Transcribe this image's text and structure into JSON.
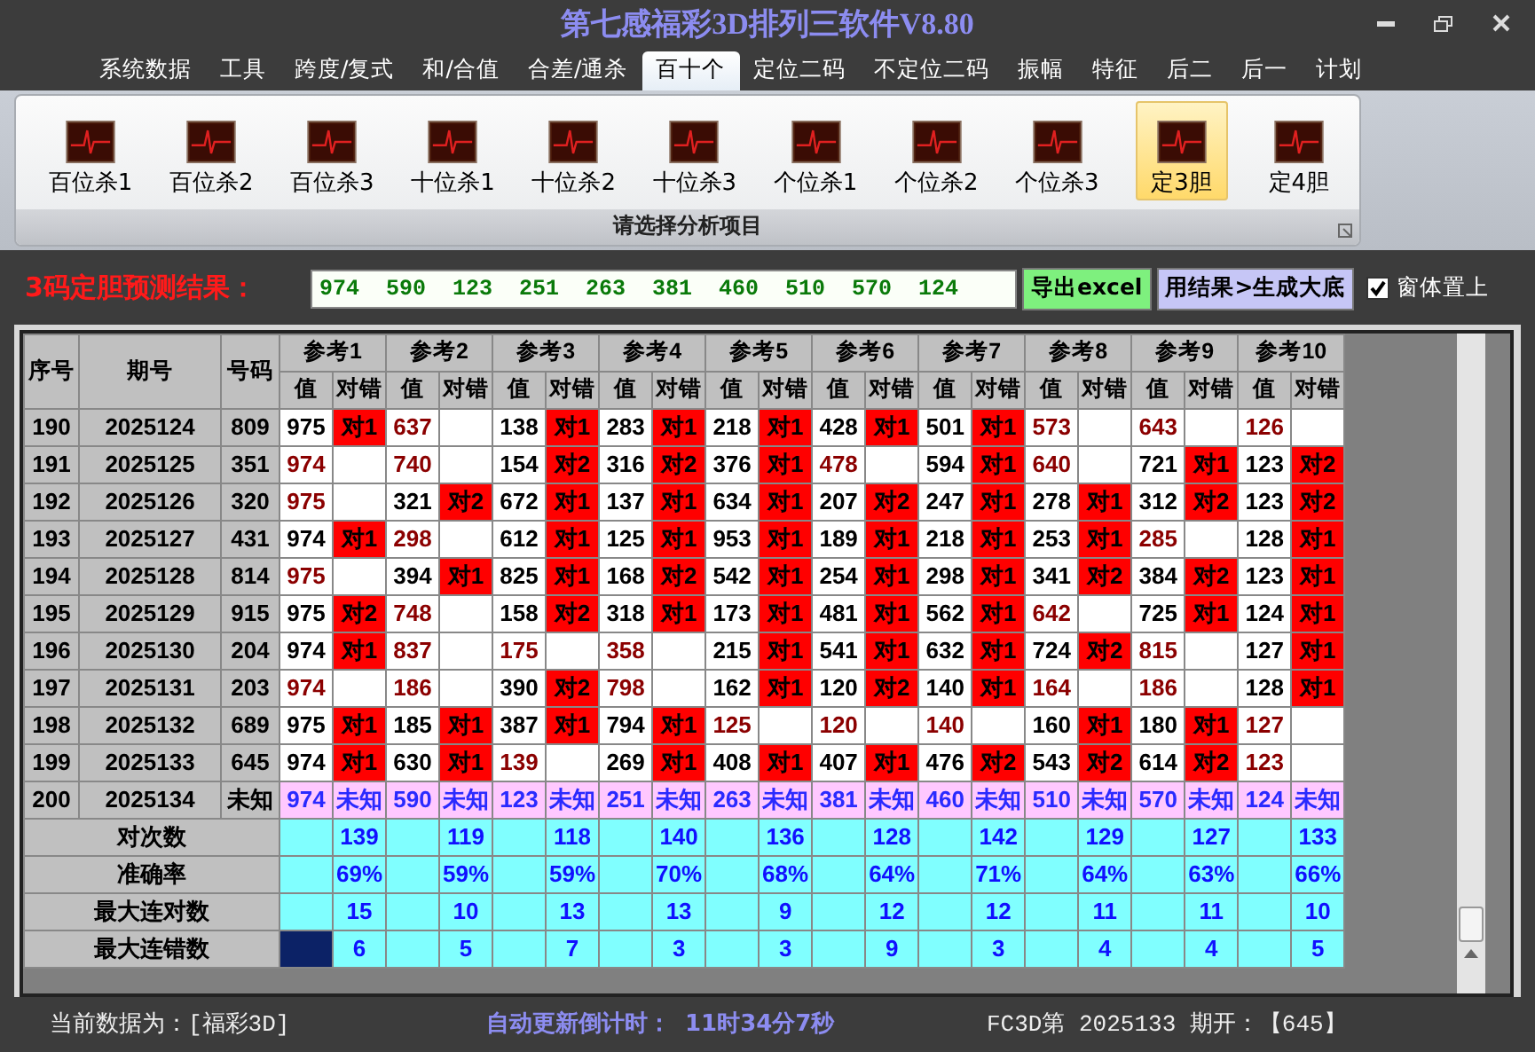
{
  "window": {
    "title": "第七感福彩3D排列三软件V8.80"
  },
  "menu": [
    {
      "label": "系统数据",
      "selected": false
    },
    {
      "label": "工具",
      "selected": false
    },
    {
      "label": "跨度/复式",
      "selected": false
    },
    {
      "label": "和/合值",
      "selected": false
    },
    {
      "label": "合差/通杀",
      "selected": false
    },
    {
      "label": "百十个",
      "selected": true
    },
    {
      "label": "定位二码",
      "selected": false
    },
    {
      "label": "不定位二码",
      "selected": false
    },
    {
      "label": "振幅",
      "selected": false
    },
    {
      "label": "特征",
      "selected": false
    },
    {
      "label": "后二",
      "selected": false
    },
    {
      "label": "后一",
      "selected": false
    },
    {
      "label": "计划",
      "selected": false
    }
  ],
  "ribbon": {
    "buttons": [
      {
        "label": "百位杀1",
        "selected": false
      },
      {
        "label": "百位杀2",
        "selected": false
      },
      {
        "label": "百位杀3",
        "selected": false
      },
      {
        "label": "十位杀1",
        "selected": false
      },
      {
        "label": "十位杀2",
        "selected": false
      },
      {
        "label": "十位杀3",
        "selected": false
      },
      {
        "label": "个位杀1",
        "selected": false
      },
      {
        "label": "个位杀2",
        "selected": false
      },
      {
        "label": "个位杀3",
        "selected": false
      },
      {
        "label": "定3胆",
        "selected": true
      },
      {
        "label": "定4胆",
        "selected": false
      }
    ],
    "group_label": "请选择分析项目"
  },
  "prediction": {
    "label": "3码定胆预测结果：",
    "value": "974  590  123  251  263  381  460  510  570  124",
    "buttons": [
      {
        "label": "导出excel",
        "kind": "export"
      },
      {
        "label": "用结果>生成大底",
        "kind": "generate"
      }
    ],
    "pin_on_top": {
      "label": "窗体置上",
      "checked": true
    }
  },
  "table": {
    "columns": [
      "序号",
      "期号",
      "号码"
    ],
    "groups": [
      {
        "label": "参考1",
        "subcolumns": [
          "值",
          "对错"
        ]
      },
      {
        "label": "参考2",
        "subcolumns": [
          "值",
          "对错"
        ]
      },
      {
        "label": "参考3",
        "subcolumns": [
          "值",
          "对错"
        ]
      },
      {
        "label": "参考4",
        "subcolumns": [
          "值",
          "对错"
        ]
      },
      {
        "label": "参考5",
        "subcolumns": [
          "值",
          "对错"
        ]
      },
      {
        "label": "参考6",
        "subcolumns": [
          "值",
          "对错"
        ]
      },
      {
        "label": "参考7",
        "subcolumns": [
          "值",
          "对错"
        ]
      },
      {
        "label": "参考8",
        "subcolumns": [
          "值",
          "对错"
        ]
      },
      {
        "label": "参考9",
        "subcolumns": [
          "值",
          "对错"
        ]
      },
      {
        "label": "参考10",
        "subcolumns": [
          "值",
          "对错"
        ]
      }
    ],
    "rows": [
      {
        "kind": "history",
        "no": "190",
        "period": "2025124",
        "number": "809",
        "cells": [
          {
            "value": "975",
            "mark": "对1"
          },
          {
            "value": "637"
          },
          {
            "value": "138",
            "mark": "对1"
          },
          {
            "value": "283",
            "mark": "对1"
          },
          {
            "value": "218",
            "mark": "对1"
          },
          {
            "value": "428",
            "mark": "对1"
          },
          {
            "value": "501",
            "mark": "对1"
          },
          {
            "value": "573"
          },
          {
            "value": "643"
          },
          {
            "value": "126"
          }
        ]
      },
      {
        "kind": "history",
        "no": "191",
        "period": "2025125",
        "number": "351",
        "cells": [
          {
            "value": "974"
          },
          {
            "value": "740"
          },
          {
            "value": "154",
            "mark": "对2"
          },
          {
            "value": "316",
            "mark": "对2"
          },
          {
            "value": "376",
            "mark": "对1"
          },
          {
            "value": "478"
          },
          {
            "value": "594",
            "mark": "对1"
          },
          {
            "value": "640"
          },
          {
            "value": "721",
            "mark": "对1"
          },
          {
            "value": "123",
            "mark": "对2"
          }
        ]
      },
      {
        "kind": "history",
        "no": "192",
        "period": "2025126",
        "number": "320",
        "cells": [
          {
            "value": "975"
          },
          {
            "value": "321",
            "mark": "对2"
          },
          {
            "value": "672",
            "mark": "对1"
          },
          {
            "value": "137",
            "mark": "对1"
          },
          {
            "value": "634",
            "mark": "对1"
          },
          {
            "value": "207",
            "mark": "对2"
          },
          {
            "value": "247",
            "mark": "对1"
          },
          {
            "value": "278",
            "mark": "对1"
          },
          {
            "value": "312",
            "mark": "对2"
          },
          {
            "value": "123",
            "mark": "对2"
          }
        ]
      },
      {
        "kind": "history",
        "no": "193",
        "period": "2025127",
        "number": "431",
        "cells": [
          {
            "value": "974",
            "mark": "对1"
          },
          {
            "value": "298"
          },
          {
            "value": "612",
            "mark": "对1"
          },
          {
            "value": "125",
            "mark": "对1"
          },
          {
            "value": "953",
            "mark": "对1"
          },
          {
            "value": "189",
            "mark": "对1"
          },
          {
            "value": "218",
            "mark": "对1"
          },
          {
            "value": "253",
            "mark": "对1"
          },
          {
            "value": "285"
          },
          {
            "value": "128",
            "mark": "对1"
          }
        ]
      },
      {
        "kind": "history",
        "no": "194",
        "period": "2025128",
        "number": "814",
        "cells": [
          {
            "value": "975"
          },
          {
            "value": "394",
            "mark": "对1"
          },
          {
            "value": "825",
            "mark": "对1"
          },
          {
            "value": "168",
            "mark": "对2"
          },
          {
            "value": "542",
            "mark": "对1"
          },
          {
            "value": "254",
            "mark": "对1"
          },
          {
            "value": "298",
            "mark": "对1"
          },
          {
            "value": "341",
            "mark": "对2"
          },
          {
            "value": "384",
            "mark": "对2"
          },
          {
            "value": "123",
            "mark": "对1"
          }
        ]
      },
      {
        "kind": "history",
        "no": "195",
        "period": "2025129",
        "number": "915",
        "cells": [
          {
            "value": "975",
            "mark": "对2"
          },
          {
            "value": "748"
          },
          {
            "value": "158",
            "mark": "对2"
          },
          {
            "value": "318",
            "mark": "对1"
          },
          {
            "value": "173",
            "mark": "对1"
          },
          {
            "value": "481",
            "mark": "对1"
          },
          {
            "value": "562",
            "mark": "对1"
          },
          {
            "value": "642"
          },
          {
            "value": "725",
            "mark": "对1"
          },
          {
            "value": "124",
            "mark": "对1"
          }
        ]
      },
      {
        "kind": "history",
        "no": "196",
        "period": "2025130",
        "number": "204",
        "cells": [
          {
            "value": "974",
            "mark": "对1"
          },
          {
            "value": "837"
          },
          {
            "value": "175"
          },
          {
            "value": "358"
          },
          {
            "value": "215",
            "mark": "对1"
          },
          {
            "value": "541",
            "mark": "对1"
          },
          {
            "value": "632",
            "mark": "对1"
          },
          {
            "value": "724",
            "mark": "对2"
          },
          {
            "value": "815"
          },
          {
            "value": "127",
            "mark": "对1"
          }
        ]
      },
      {
        "kind": "history",
        "no": "197",
        "period": "2025131",
        "number": "203",
        "cells": [
          {
            "value": "974"
          },
          {
            "value": "186"
          },
          {
            "value": "390",
            "mark": "对2"
          },
          {
            "value": "798"
          },
          {
            "value": "162",
            "mark": "对1"
          },
          {
            "value": "120",
            "mark": "对2"
          },
          {
            "value": "140",
            "mark": "对1"
          },
          {
            "value": "164"
          },
          {
            "value": "186"
          },
          {
            "value": "128",
            "mark": "对1"
          }
        ]
      },
      {
        "kind": "history",
        "no": "198",
        "period": "2025132",
        "number": "689",
        "cells": [
          {
            "value": "975",
            "mark": "对1"
          },
          {
            "value": "185",
            "mark": "对1"
          },
          {
            "value": "387",
            "mark": "对1"
          },
          {
            "value": "794",
            "mark": "对1"
          },
          {
            "value": "125"
          },
          {
            "value": "120"
          },
          {
            "value": "140"
          },
          {
            "value": "160",
            "mark": "对1"
          },
          {
            "value": "180",
            "mark": "对1"
          },
          {
            "value": "127"
          }
        ]
      },
      {
        "kind": "history",
        "no": "199",
        "period": "2025133",
        "number": "645",
        "cells": [
          {
            "value": "974",
            "mark": "对1"
          },
          {
            "value": "630",
            "mark": "对1"
          },
          {
            "value": "139"
          },
          {
            "value": "269",
            "mark": "对1"
          },
          {
            "value": "408",
            "mark": "对1"
          },
          {
            "value": "407",
            "mark": "对1"
          },
          {
            "value": "476",
            "mark": "对2"
          },
          {
            "value": "543",
            "mark": "对2"
          },
          {
            "value": "614",
            "mark": "对2"
          },
          {
            "value": "123"
          }
        ]
      },
      {
        "kind": "pending",
        "no": "200",
        "period": "2025134",
        "number": "未知",
        "cells": [
          {
            "value": "974",
            "mark": "未知"
          },
          {
            "value": "590",
            "mark": "未知"
          },
          {
            "value": "123",
            "mark": "未知"
          },
          {
            "value": "251",
            "mark": "未知"
          },
          {
            "value": "263",
            "mark": "未知"
          },
          {
            "value": "381",
            "mark": "未知"
          },
          {
            "value": "460",
            "mark": "未知"
          },
          {
            "value": "510",
            "mark": "未知"
          },
          {
            "value": "570",
            "mark": "未知"
          },
          {
            "value": "124",
            "mark": "未知"
          }
        ]
      }
    ],
    "stats": [
      {
        "label": "对次数",
        "cells": [
          {
            "value": "139",
            "selected": false
          },
          {
            "value": "119",
            "selected": false
          },
          {
            "value": "118",
            "selected": false
          },
          {
            "value": "140",
            "selected": false
          },
          {
            "value": "136",
            "selected": false
          },
          {
            "value": "128",
            "selected": false
          },
          {
            "value": "142",
            "selected": false
          },
          {
            "value": "129",
            "selected": false
          },
          {
            "value": "127",
            "selected": false
          },
          {
            "value": "133",
            "selected": false
          }
        ]
      },
      {
        "label": "准确率",
        "cells": [
          {
            "value": "69%",
            "selected": false
          },
          {
            "value": "59%",
            "selected": false
          },
          {
            "value": "59%",
            "selected": false
          },
          {
            "value": "70%",
            "selected": false
          },
          {
            "value": "68%",
            "selected": false
          },
          {
            "value": "64%",
            "selected": false
          },
          {
            "value": "71%",
            "selected": false
          },
          {
            "value": "64%",
            "selected": false
          },
          {
            "value": "63%",
            "selected": false
          },
          {
            "value": "66%",
            "selected": false
          }
        ]
      },
      {
        "label": "最大连对数",
        "cells": [
          {
            "value": "15",
            "selected": false
          },
          {
            "value": "10",
            "selected": false
          },
          {
            "value": "13",
            "selected": false
          },
          {
            "value": "13",
            "selected": false
          },
          {
            "value": "9",
            "selected": false
          },
          {
            "value": "12",
            "selected": false
          },
          {
            "value": "12",
            "selected": false
          },
          {
            "value": "11",
            "selected": false
          },
          {
            "value": "11",
            "selected": false
          },
          {
            "value": "10",
            "selected": false
          }
        ]
      },
      {
        "label": "最大连错数",
        "cells": [
          {
            "value": "6",
            "selected": true
          },
          {
            "value": "5",
            "selected": false
          },
          {
            "value": "7",
            "selected": false
          },
          {
            "value": "3",
            "selected": false
          },
          {
            "value": "3",
            "selected": false
          },
          {
            "value": "9",
            "selected": false
          },
          {
            "value": "3",
            "selected": false
          },
          {
            "value": "4",
            "selected": false
          },
          {
            "value": "4",
            "selected": false
          },
          {
            "value": "5",
            "selected": false
          }
        ]
      }
    ]
  },
  "status_bar": {
    "data_source": "当前数据为：[福彩3D]",
    "countdown_label": "自动更新倒计时：",
    "countdown": "11时34分7秒",
    "latest": "FC3D第 2025133 期开：【645】"
  }
}
